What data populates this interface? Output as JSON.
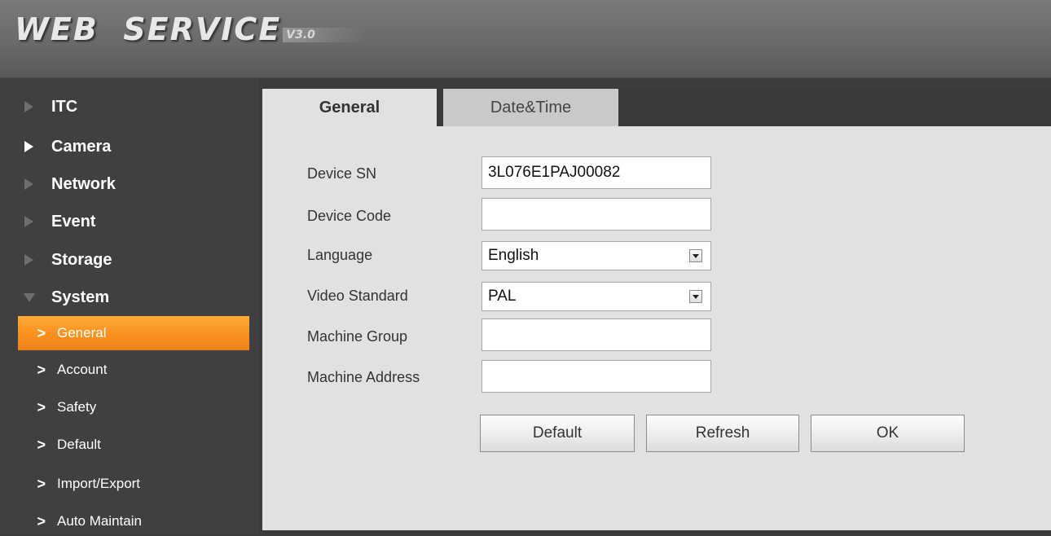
{
  "header": {
    "logo_text": "WEB  SERVICE",
    "logo_version": "V3.0"
  },
  "sidebar": {
    "sections": [
      {
        "label": "ITC",
        "icon": "triangle-right-icon"
      },
      {
        "label": "Camera",
        "icon": "triangle-right-icon"
      },
      {
        "label": "Network",
        "icon": "triangle-right-icon"
      },
      {
        "label": "Event",
        "icon": "triangle-right-icon"
      },
      {
        "label": "Storage",
        "icon": "triangle-right-icon"
      },
      {
        "label": "System",
        "icon": "triangle-down-icon"
      }
    ],
    "system_items": [
      {
        "label": "General",
        "active": true
      },
      {
        "label": "Account"
      },
      {
        "label": "Safety"
      },
      {
        "label": "Default"
      },
      {
        "label": "Import/Export"
      },
      {
        "label": "Auto Maintain"
      }
    ],
    "chevron": ">",
    "active_color": "#f99320"
  },
  "tabs": [
    {
      "label": "General",
      "active": true
    },
    {
      "label": "Date&Time",
      "active": false
    }
  ],
  "form": {
    "device_sn": {
      "label": "Device SN",
      "value": "3L076E1PAJ00082"
    },
    "device_code": {
      "label": "Device Code",
      "value": ""
    },
    "language": {
      "label": "Language",
      "value": "English"
    },
    "video_standard": {
      "label": "Video Standard",
      "value": "PAL"
    },
    "machine_group": {
      "label": "Machine Group",
      "value": ""
    },
    "machine_address": {
      "label": "Machine Address",
      "value": ""
    }
  },
  "buttons": {
    "default": "Default",
    "refresh": "Refresh",
    "ok": "OK"
  }
}
